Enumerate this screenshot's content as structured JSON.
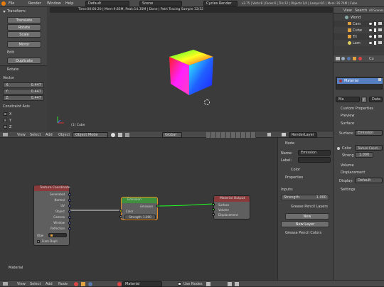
{
  "menu": {
    "items": [
      "File",
      "Render",
      "Window",
      "Help"
    ],
    "layout": "Default",
    "scene": "Scene",
    "engine": "Cycles Render",
    "info": "v2.75 | Verts:8 | Faces:6 | Tris:12 | Objects:1/4 | Lamps:0/1 | Mem: 26.74M | Cube"
  },
  "render_status": "Time:00:00.20 | Mem:9.85M, Peak:14.35M | Done | Path Tracing Sample 32/32",
  "toolshelf": {
    "transform_header": "Transform:",
    "buttons": [
      "Translate",
      "Rotate",
      "Scale"
    ],
    "mirror": "Mirror",
    "edit_header": "Edit",
    "duplicate": "Duplicate",
    "rotate_header": "Rotate",
    "vector_label": "Vector",
    "x": "X:",
    "x_val": "0.447",
    "y": "Y:",
    "y_val": "0.447",
    "z": "Z:",
    "z_val": "0.447",
    "constraint": "Constraint Axis",
    "cx": "X",
    "cy": "Y",
    "cz": "Z",
    "orientation": "Orientation"
  },
  "viewport": {
    "object_label": "(1) Cube",
    "header": {
      "view": "View",
      "select": "Select",
      "add": "Add",
      "object": "Object",
      "mode": "Object Mode",
      "orientation": "Global",
      "layer": "RenderLayer"
    }
  },
  "outliner": {
    "view": "View",
    "search": "Search",
    "all_scenes": "All Scenes",
    "items": [
      "World",
      "Cam",
      "Cube",
      "Tri",
      "Lam"
    ]
  },
  "props": {
    "material_slot": "Material",
    "object_name": "Cu",
    "data_label": "Data",
    "mat_name": "Ma",
    "custom_properties": "Custom Properties",
    "preview": "Preview",
    "surface_header": "Surface",
    "surface_label": "Surface:",
    "surface_val": "Emission",
    "color_label": "Color",
    "color_val": "Texture Coord...",
    "strength_label": "Streng",
    "strength_val": "1.000",
    "volume": "Volume",
    "displacement_header": "Displacement",
    "display_label": "Display:",
    "display_val": "Default",
    "settings": "Settings"
  },
  "node_props": {
    "node_header": "Node",
    "name_label": "Name:",
    "name_val": "Emission",
    "label_label": "Label:",
    "color": "Color",
    "properties": "Properties",
    "inputs": "Inputs:",
    "strength_label": "Strength:",
    "strength_val": "1.000",
    "gp_layers": "Grease Pencil Layers",
    "new": "New",
    "new_layer": "New Layer",
    "gp_colors": "Grease Pencil Colors"
  },
  "nodes": {
    "texcoord": {
      "title": "Texture Coordinate",
      "outputs": [
        "Generated",
        "Normal",
        "UV",
        "Object",
        "Camera",
        "Window",
        "Reflection"
      ],
      "object_label": "Obje",
      "from_dupli": "From Dupli"
    },
    "emission": {
      "title": "Emission",
      "out": "Emission",
      "color": "Color",
      "strength": "Strength: 1.000"
    },
    "output": {
      "title": "Material Output",
      "surface": "Surface",
      "volume": "Volume",
      "displacement": "Displacement"
    }
  },
  "node_editor": {
    "material_label": "Material",
    "header": {
      "view": "View",
      "select": "Select",
      "add": "Add",
      "node": "Node",
      "material": "Material",
      "use_nodes": "Use Nodes"
    }
  }
}
